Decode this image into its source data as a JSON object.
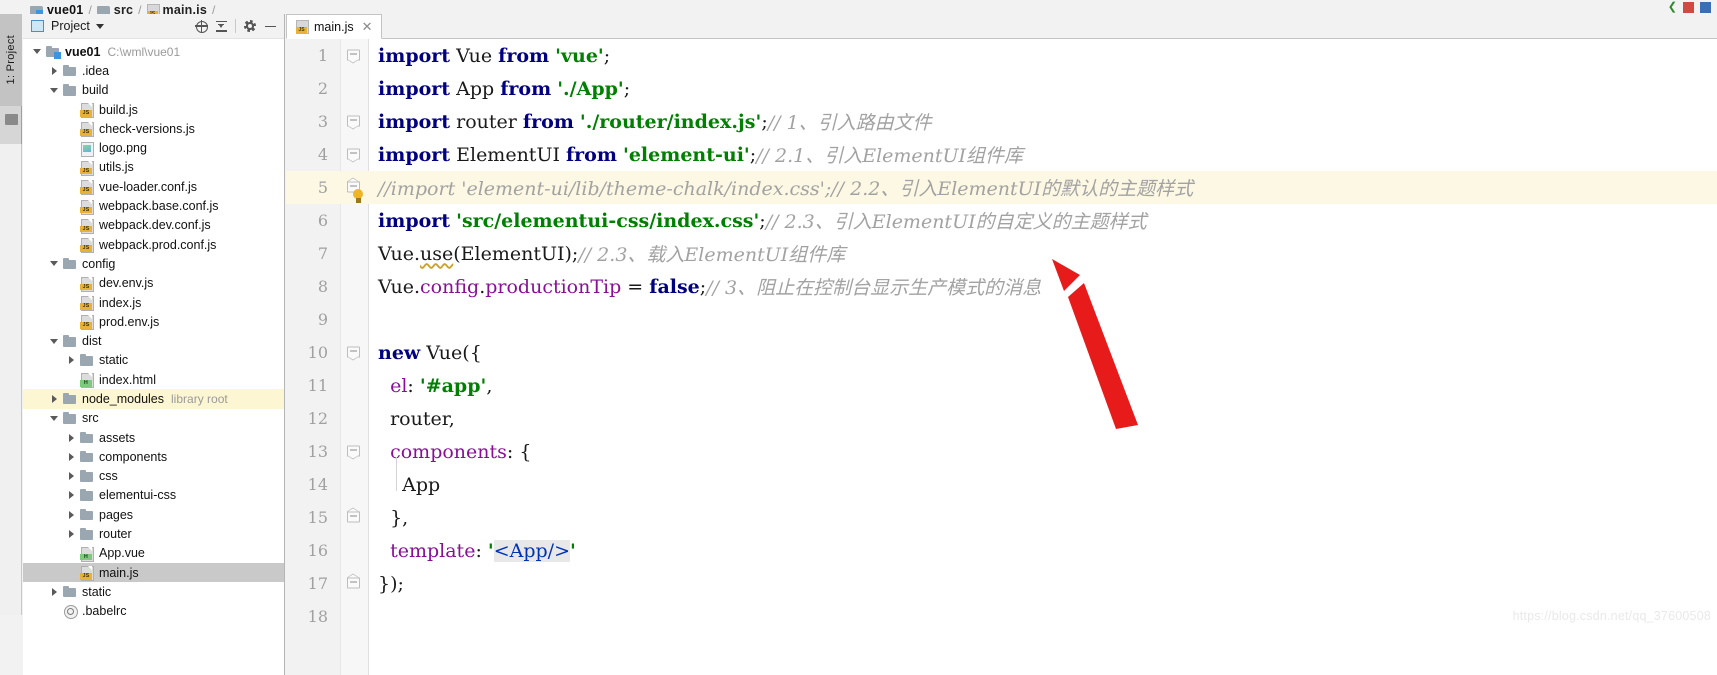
{
  "breadcrumb": {
    "items": [
      {
        "label": "vue01",
        "icon": "folder-module-icon"
      },
      {
        "label": "src",
        "icon": "folder-icon"
      },
      {
        "label": "main.js",
        "icon": "js-file-icon"
      }
    ],
    "separator": "/"
  },
  "tool_strip": {
    "project_button_label": "1: Project",
    "folder_icon": "folder-icon"
  },
  "project_panel": {
    "title": "Project",
    "window_icon": "project-window-icon",
    "dropdown_caret": "chevron-down-icon",
    "toolbar": [
      {
        "name": "locate-in-tree-icon",
        "tooltip": "Select Opened File"
      },
      {
        "name": "collapse-all-icon",
        "tooltip": "Collapse All"
      },
      {
        "name": "gear-icon",
        "tooltip": "Settings"
      },
      {
        "name": "minimize-icon",
        "tooltip": "Hide"
      }
    ],
    "tree": [
      {
        "depth": 0,
        "label": "vue01",
        "path": "C:\\wml\\vue01",
        "icon": "folder-module-icon",
        "arrow": "down",
        "bold": true
      },
      {
        "depth": 1,
        "label": ".idea",
        "icon": "folder-icon",
        "arrow": "right"
      },
      {
        "depth": 1,
        "label": "build",
        "icon": "folder-icon",
        "arrow": "down"
      },
      {
        "depth": 2,
        "label": "build.js",
        "icon": "js-file-icon",
        "arrow": "none"
      },
      {
        "depth": 2,
        "label": "check-versions.js",
        "icon": "js-file-icon",
        "arrow": "none"
      },
      {
        "depth": 2,
        "label": "logo.png",
        "icon": "image-file-icon",
        "arrow": "none"
      },
      {
        "depth": 2,
        "label": "utils.js",
        "icon": "js-file-icon",
        "arrow": "none"
      },
      {
        "depth": 2,
        "label": "vue-loader.conf.js",
        "icon": "js-file-icon",
        "arrow": "none"
      },
      {
        "depth": 2,
        "label": "webpack.base.conf.js",
        "icon": "js-file-icon",
        "arrow": "none"
      },
      {
        "depth": 2,
        "label": "webpack.dev.conf.js",
        "icon": "js-file-icon",
        "arrow": "none"
      },
      {
        "depth": 2,
        "label": "webpack.prod.conf.js",
        "icon": "js-file-icon",
        "arrow": "none"
      },
      {
        "depth": 1,
        "label": "config",
        "icon": "folder-icon",
        "arrow": "down"
      },
      {
        "depth": 2,
        "label": "dev.env.js",
        "icon": "js-file-icon",
        "arrow": "none"
      },
      {
        "depth": 2,
        "label": "index.js",
        "icon": "js-file-icon",
        "arrow": "none"
      },
      {
        "depth": 2,
        "label": "prod.env.js",
        "icon": "js-file-icon",
        "arrow": "none"
      },
      {
        "depth": 1,
        "label": "dist",
        "icon": "folder-icon",
        "arrow": "down"
      },
      {
        "depth": 2,
        "label": "static",
        "icon": "folder-icon",
        "arrow": "right"
      },
      {
        "depth": 2,
        "label": "index.html",
        "icon": "html-file-icon",
        "arrow": "none"
      },
      {
        "depth": 1,
        "label": "node_modules",
        "note": "library root",
        "icon": "folder-icon",
        "arrow": "right",
        "highlight": "library-root"
      },
      {
        "depth": 1,
        "label": "src",
        "icon": "folder-icon",
        "arrow": "down"
      },
      {
        "depth": 2,
        "label": "assets",
        "icon": "folder-icon",
        "arrow": "right"
      },
      {
        "depth": 2,
        "label": "components",
        "icon": "folder-icon",
        "arrow": "right"
      },
      {
        "depth": 2,
        "label": "css",
        "icon": "folder-icon",
        "arrow": "right"
      },
      {
        "depth": 2,
        "label": "elementui-css",
        "icon": "folder-icon",
        "arrow": "right"
      },
      {
        "depth": 2,
        "label": "pages",
        "icon": "folder-icon",
        "arrow": "right"
      },
      {
        "depth": 2,
        "label": "router",
        "icon": "folder-icon",
        "arrow": "right"
      },
      {
        "depth": 2,
        "label": "App.vue",
        "icon": "html-file-icon",
        "arrow": "none"
      },
      {
        "depth": 2,
        "label": "main.js",
        "icon": "js-file-icon",
        "arrow": "none",
        "selected": true
      },
      {
        "depth": 1,
        "label": "static",
        "icon": "folder-icon",
        "arrow": "right"
      },
      {
        "depth": 1,
        "label": ".babelrc",
        "icon": "babel-file-icon",
        "arrow": "none"
      }
    ]
  },
  "editor": {
    "tab": {
      "label": "main.js",
      "icon": "js-file-icon",
      "close_icon": "close-icon"
    },
    "highlighted_line": 5,
    "lines": [
      {
        "num": "1",
        "fold": "start",
        "tokens": [
          {
            "t": "import",
            "c": "kw"
          },
          {
            "t": " Vue ",
            "c": "plain"
          },
          {
            "t": "from",
            "c": "kw"
          },
          {
            "t": " ",
            "c": "plain"
          },
          {
            "t": "'vue'",
            "c": "str"
          },
          {
            "t": ";",
            "c": "plain"
          }
        ]
      },
      {
        "num": "2",
        "fold": "none",
        "tokens": [
          {
            "t": "import",
            "c": "kw"
          },
          {
            "t": " App ",
            "c": "plain"
          },
          {
            "t": "from",
            "c": "kw"
          },
          {
            "t": " ",
            "c": "plain"
          },
          {
            "t": "'./App'",
            "c": "str"
          },
          {
            "t": ";",
            "c": "plain"
          }
        ]
      },
      {
        "num": "3",
        "fold": "start",
        "tokens": [
          {
            "t": "import",
            "c": "kw"
          },
          {
            "t": " router ",
            "c": "plain"
          },
          {
            "t": "from",
            "c": "kw"
          },
          {
            "t": " ",
            "c": "plain"
          },
          {
            "t": "'./router/index.js'",
            "c": "str"
          },
          {
            "t": ";",
            "c": "plain"
          },
          {
            "t": "// 1、引入路由文件",
            "c": "cmt"
          }
        ]
      },
      {
        "num": "4",
        "fold": "start",
        "tokens": [
          {
            "t": "import",
            "c": "kw"
          },
          {
            "t": " ElementUI ",
            "c": "plain"
          },
          {
            "t": "from",
            "c": "kw"
          },
          {
            "t": " ",
            "c": "plain"
          },
          {
            "t": "'element-ui'",
            "c": "str"
          },
          {
            "t": ";",
            "c": "plain"
          },
          {
            "t": "// 2.1、引入ElementUI组件库",
            "c": "cmt"
          }
        ]
      },
      {
        "num": "5",
        "fold": "end",
        "highlight": true,
        "tokens": [
          {
            "t": "//import 'element-ui/lib/theme-chalk/index.css';// 2.2、引入ElementUI的默认的主题样式",
            "c": "cmt-line"
          }
        ]
      },
      {
        "num": "6",
        "fold": "none",
        "tokens": [
          {
            "t": "import",
            "c": "kw"
          },
          {
            "t": " ",
            "c": "plain"
          },
          {
            "t": "'src/elementui-css/index.css'",
            "c": "str"
          },
          {
            "t": ";",
            "c": "plain"
          },
          {
            "t": "// 2.3、引入ElementUI的自定义的主题样式",
            "c": "cmt"
          }
        ]
      },
      {
        "num": "7",
        "fold": "none",
        "tokens": [
          {
            "t": "Vue.",
            "c": "plain"
          },
          {
            "t": "use",
            "c": "fn-und"
          },
          {
            "t": "(ElementUI);",
            "c": "plain"
          },
          {
            "t": "// 2.3、载入ElementUI组件库",
            "c": "cmt"
          }
        ]
      },
      {
        "num": "8",
        "fold": "none",
        "tokens": [
          {
            "t": "Vue.",
            "c": "plain"
          },
          {
            "t": "config",
            "c": "prop"
          },
          {
            "t": ".",
            "c": "plain"
          },
          {
            "t": "productionTip",
            "c": "prop"
          },
          {
            "t": " = ",
            "c": "plain"
          },
          {
            "t": "false",
            "c": "kw"
          },
          {
            "t": ";",
            "c": "plain"
          },
          {
            "t": "// 3、阻止在控制台显示生产模式的消息",
            "c": "cmt"
          }
        ]
      },
      {
        "num": "9",
        "fold": "none",
        "tokens": []
      },
      {
        "num": "10",
        "fold": "start",
        "tokens": [
          {
            "t": "new",
            "c": "kw"
          },
          {
            "t": " Vue({",
            "c": "plain"
          }
        ]
      },
      {
        "num": "11",
        "fold": "none",
        "indent": 1,
        "tokens": [
          {
            "t": "  ",
            "c": "plain"
          },
          {
            "t": "el",
            "c": "prop"
          },
          {
            "t": ": ",
            "c": "plain"
          },
          {
            "t": "'#app'",
            "c": "str"
          },
          {
            "t": ",",
            "c": "plain"
          }
        ]
      },
      {
        "num": "12",
        "fold": "none",
        "indent": 1,
        "tokens": [
          {
            "t": "  router,",
            "c": "plain"
          }
        ]
      },
      {
        "num": "13",
        "fold": "start",
        "indent": 1,
        "tokens": [
          {
            "t": "  ",
            "c": "plain"
          },
          {
            "t": "components",
            "c": "prop"
          },
          {
            "t": ": {",
            "c": "plain"
          }
        ]
      },
      {
        "num": "14",
        "fold": "none",
        "indent": 2,
        "tokens": [
          {
            "t": "    App",
            "c": "plain"
          }
        ]
      },
      {
        "num": "15",
        "fold": "end",
        "indent": 1,
        "tokens": [
          {
            "t": "  },",
            "c": "plain"
          }
        ]
      },
      {
        "num": "16",
        "fold": "none",
        "indent": 1,
        "tokens": [
          {
            "t": "  ",
            "c": "plain"
          },
          {
            "t": "template",
            "c": "prop"
          },
          {
            "t": ": ",
            "c": "plain"
          },
          {
            "t": "'",
            "c": "str"
          },
          {
            "t": "<App/>",
            "c": "tagname",
            "bg": true
          },
          {
            "t": "'",
            "c": "str"
          }
        ]
      },
      {
        "num": "17",
        "fold": "end",
        "tokens": [
          {
            "t": "});",
            "c": "plain"
          }
        ]
      },
      {
        "num": "18",
        "fold": "none",
        "tokens": []
      }
    ]
  },
  "annotation": {
    "type": "red-arrow",
    "color": "#e81b1b",
    "points_to": "line-6-import-statement"
  },
  "watermark": {
    "text": "https://blog.csdn.net/qq_37600508"
  },
  "colors": {
    "keyword": "#000080",
    "string": "#008000",
    "comment": "#a2a2a2",
    "property": "#871094",
    "tag": "#0033b3",
    "highlight_line": "#fdf8e3",
    "selection": "#c9c9c9",
    "library_root": "#fdf6d3",
    "annotation_red": "#e81b1b"
  }
}
